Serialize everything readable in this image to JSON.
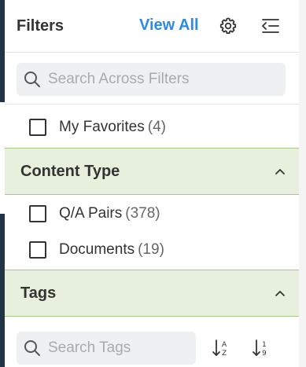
{
  "header": {
    "title": "Filters",
    "view_all": "View All",
    "settings_icon": "gear-icon",
    "collapse_icon": "collapse-panel-icon"
  },
  "search": {
    "placeholder": "Search Across Filters"
  },
  "favorites": {
    "label": "My Favorites",
    "count": "(4)",
    "checked": false
  },
  "content_type": {
    "title": "Content Type",
    "expanded": true,
    "items": [
      {
        "label": "Q/A Pairs",
        "count": "(378)",
        "checked": false
      },
      {
        "label": "Documents",
        "count": "(19)",
        "checked": false
      }
    ]
  },
  "tags": {
    "title": "Tags",
    "expanded": true,
    "search_placeholder": "Search Tags",
    "sort_alpha_icon": "sort-alpha-icon",
    "sort_numeric_icon": "sort-numeric-icon"
  },
  "colors": {
    "accent": "#2b8be6",
    "section_bg": "#e7f0dc",
    "section_border": "#a9c98c",
    "left_edge": "#1f3447"
  }
}
